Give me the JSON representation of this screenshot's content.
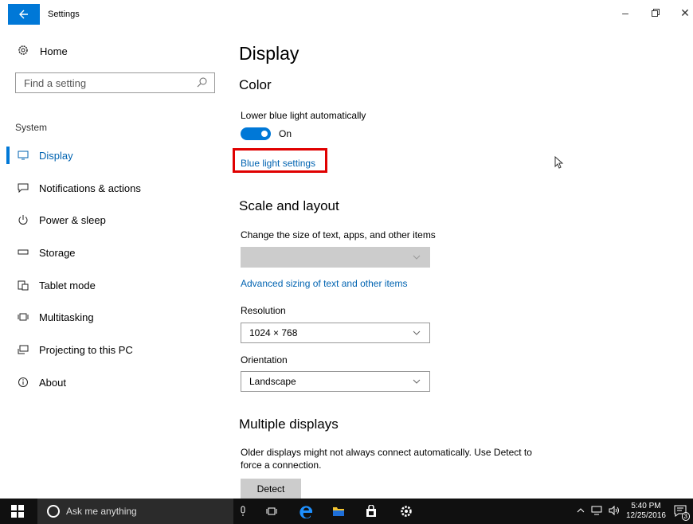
{
  "window": {
    "title": "Settings"
  },
  "sidebar": {
    "home_label": "Home",
    "search_placeholder": "Find a setting",
    "section_label": "System",
    "items": [
      {
        "label": "Display",
        "icon": "monitor-icon",
        "active": true
      },
      {
        "label": "Notifications & actions",
        "icon": "notification-icon"
      },
      {
        "label": "Power & sleep",
        "icon": "power-icon"
      },
      {
        "label": "Storage",
        "icon": "storage-icon"
      },
      {
        "label": "Tablet mode",
        "icon": "tablet-icon"
      },
      {
        "label": "Multitasking",
        "icon": "multitasking-icon"
      },
      {
        "label": "Projecting to this PC",
        "icon": "projecting-icon"
      },
      {
        "label": "About",
        "icon": "info-icon"
      }
    ]
  },
  "main": {
    "title": "Display",
    "color_heading": "Color",
    "blue_light_label": "Lower blue light automatically",
    "toggle_state": "On",
    "blue_light_link": "Blue light settings",
    "scale_heading": "Scale and layout",
    "scale_label": "Change the size of text, apps, and other items",
    "advanced_link": "Advanced sizing of text and other items",
    "resolution_label": "Resolution",
    "resolution_value": "1024 × 768",
    "orientation_label": "Orientation",
    "orientation_value": "Landscape",
    "multi_heading": "Multiple displays",
    "multi_text": "Older displays might not always connect automatically. Use Detect to force a connection.",
    "detect_button": "Detect"
  },
  "taskbar": {
    "search_text": "Ask me anything",
    "time": "5:40 PM",
    "date": "12/25/2016",
    "notification_count": "3"
  },
  "colors": {
    "accent": "#0078d7",
    "link": "#0063b1",
    "highlight": "#e00000",
    "taskbar": "#101010"
  }
}
